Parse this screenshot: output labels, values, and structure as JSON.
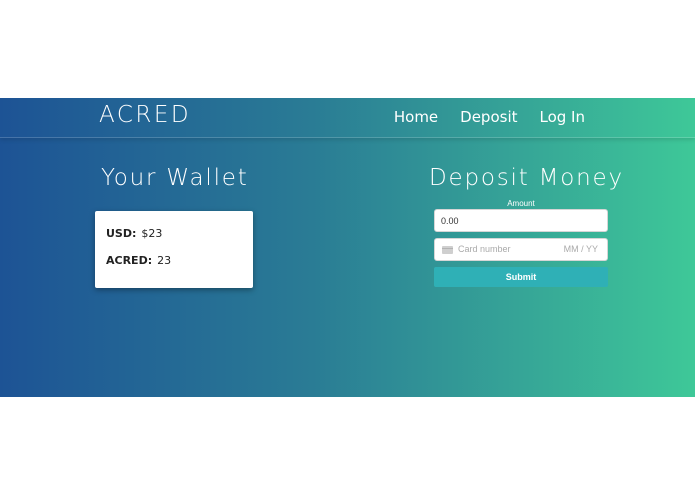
{
  "colors": {
    "gradient_start": "#1d5395",
    "gradient_end": "#3ec898",
    "submit_bg": "#2fb0b6"
  },
  "navbar": {
    "brand": "ACRED",
    "links": [
      "Home",
      "Deposit",
      "Log In"
    ]
  },
  "wallet": {
    "title": "Your Wallet",
    "usd_label": "USD:",
    "usd_value": "$23",
    "acred_label": "ACRED:",
    "acred_value": "23"
  },
  "deposit": {
    "title": "Deposit Money",
    "amount_label": "Amount",
    "amount_value": "0.00",
    "card_icon": "credit-card-icon",
    "card_number_placeholder": "Card number",
    "card_expiry_placeholder": "MM / YY",
    "submit_label": "Submit"
  }
}
